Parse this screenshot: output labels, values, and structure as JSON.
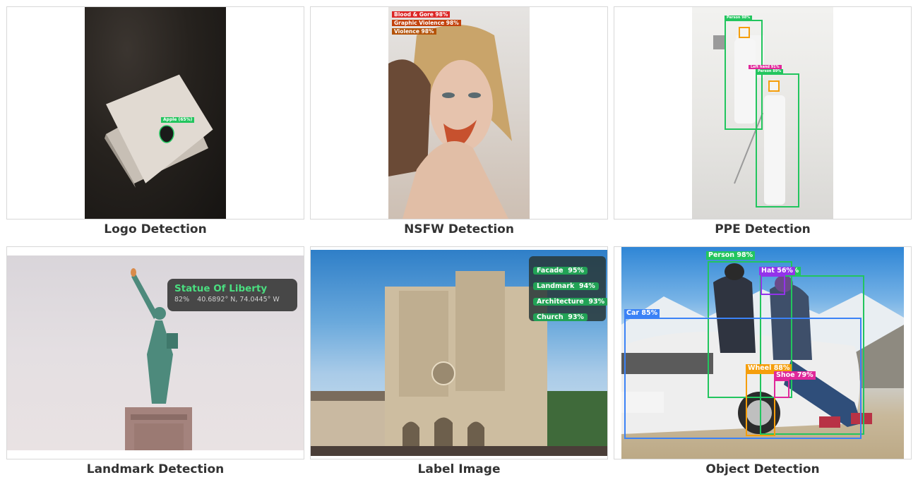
{
  "cards": [
    {
      "caption": "Logo Detection",
      "tags": [
        "Apple (65%)"
      ]
    },
    {
      "caption": "NSFW Detection",
      "tags": [
        "Blood & Gore 98%",
        "Graphic Violence 98%",
        "Violence 98%"
      ]
    },
    {
      "caption": "PPE Detection",
      "tags": [
        "Person 98%",
        "Hard hat",
        "Left hand 91%",
        "Person 89%",
        "Hard hat"
      ]
    },
    {
      "caption": "Landmark Detection",
      "landmark": {
        "name": "Statue Of Liberty",
        "confidence": "82%",
        "coords": "40.6892° N, 74.0445° W"
      }
    },
    {
      "caption": "Label Image",
      "labels": [
        {
          "name": "Facade",
          "score": "95%"
        },
        {
          "name": "Landmark",
          "score": "94%"
        },
        {
          "name": "Architecture",
          "score": "93%"
        },
        {
          "name": "Church",
          "score": "93%"
        }
      ]
    },
    {
      "caption": "Object Detection",
      "tags": [
        "Person 98%",
        "Hat 56%",
        "8%",
        "Car 85%",
        "Wheel 88%",
        "Shoe 79%"
      ]
    }
  ],
  "colors": {
    "green": "#22c55e",
    "blue": "#3b82f6",
    "purple": "#9333ea",
    "orange": "#f59e0b",
    "pink": "#e0289a",
    "red": "#dc2626"
  }
}
